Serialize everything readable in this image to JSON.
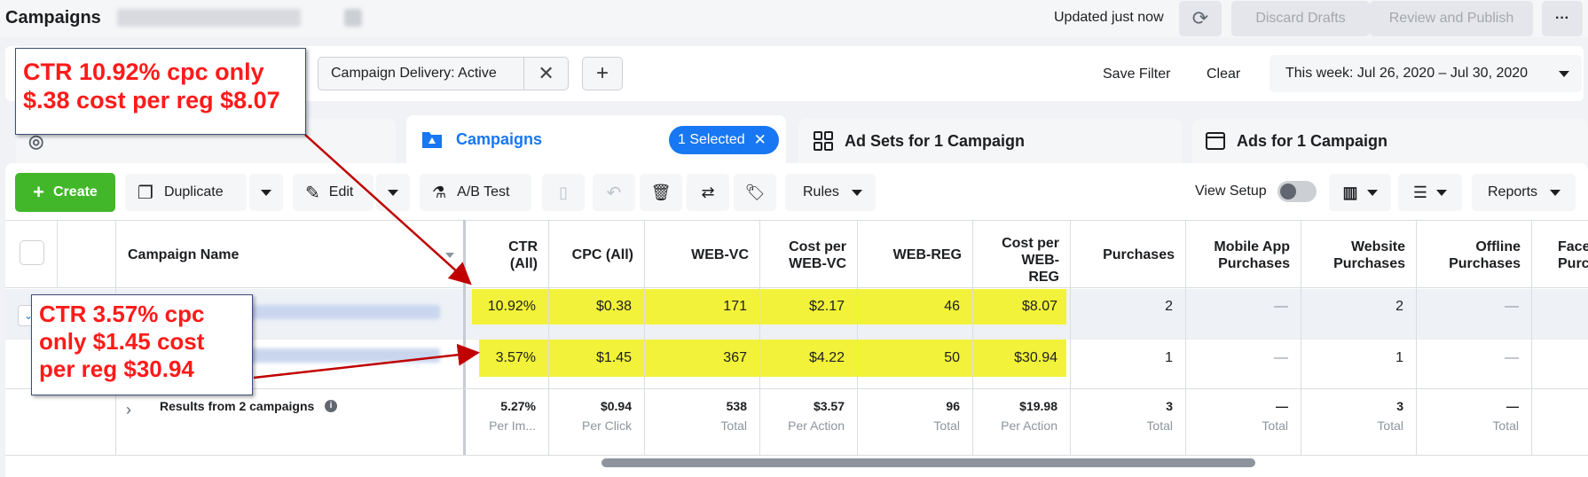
{
  "header": {
    "title": "Campaigns",
    "updated": "Updated just now",
    "discard": "Discard Drafts",
    "review": "Review and Publish",
    "more": "···"
  },
  "filters": {
    "chip_label": "Campaign Delivery:  Active",
    "save_filter": "Save Filter",
    "clear": "Clear",
    "date_range": "This week: Jul 26, 2020 – Jul 30, 2020"
  },
  "tabs": {
    "campaigns": "Campaigns",
    "selected": "1 Selected",
    "adsets": "Ad Sets for 1 Campaign",
    "ads": "Ads for 1 Campaign"
  },
  "toolbar": {
    "create": "Create",
    "duplicate": "Duplicate",
    "edit": "Edit",
    "ab_test": "A/B Test",
    "rules": "Rules",
    "view_setup": "View Setup",
    "reports": "Reports"
  },
  "table": {
    "headers": {
      "name": "Campaign Name",
      "ctr": [
        "CTR",
        "(All)"
      ],
      "cpc": "CPC (All)",
      "webvc": "WEB-VC",
      "cost_webvc": [
        "Cost per",
        "WEB-VC"
      ],
      "webreg": "WEB-REG",
      "cost_webreg": [
        "Cost per",
        "WEB-",
        "REG"
      ],
      "purchases": "Purchases",
      "mobile": [
        "Mobile App",
        "Purchases"
      ],
      "website": [
        "Website",
        "Purchases"
      ],
      "offline": [
        "Offline",
        "Purchases"
      ],
      "face": [
        "Face",
        "Purc"
      ]
    },
    "rows": [
      {
        "ctr": "10.92%",
        "cpc": "$0.38",
        "webvc": "171",
        "cost_webvc": "$2.17",
        "webreg": "46",
        "cost_webreg": "$8.07",
        "purchases": "2",
        "mobile": "—",
        "website": "2",
        "offline": "—"
      },
      {
        "ctr": "3.57%",
        "cpc": "$1.45",
        "webvc": "367",
        "cost_webvc": "$4.22",
        "webreg": "50",
        "cost_webreg": "$30.94",
        "purchases": "1",
        "mobile": "—",
        "website": "1",
        "offline": "—"
      }
    ],
    "totals": {
      "label": "Results from 2 campaigns",
      "ctr": "5.27%",
      "ctr_sub": "Per Im...",
      "cpc": "$0.94",
      "cpc_sub": "Per Click",
      "webvc": "538",
      "webvc_sub": "Total",
      "cost_webvc": "$3.57",
      "cost_webvc_sub": "Per Action",
      "webreg": "96",
      "webreg_sub": "Total",
      "cost_webreg": "$19.98",
      "cost_webreg_sub": "Per Action",
      "purchases": "3",
      "purchases_sub": "Total",
      "mobile": "—",
      "mobile_sub": "Total",
      "website": "3",
      "website_sub": "Total",
      "offline": "—",
      "offline_sub": "Total"
    }
  },
  "annotations": {
    "top": [
      "CTR 10.92% cpc only",
      "$.38 cost per reg $8.07"
    ],
    "bottom": [
      "CTR 3.57% cpc",
      "only $1.45 cost",
      "per reg $30.94"
    ]
  },
  "colors": {
    "accent": "#1877f2",
    "create": "#42b72a",
    "highlight": "#f2f23a",
    "annotation": "#ff1a1a",
    "arrow": "#c00000"
  }
}
